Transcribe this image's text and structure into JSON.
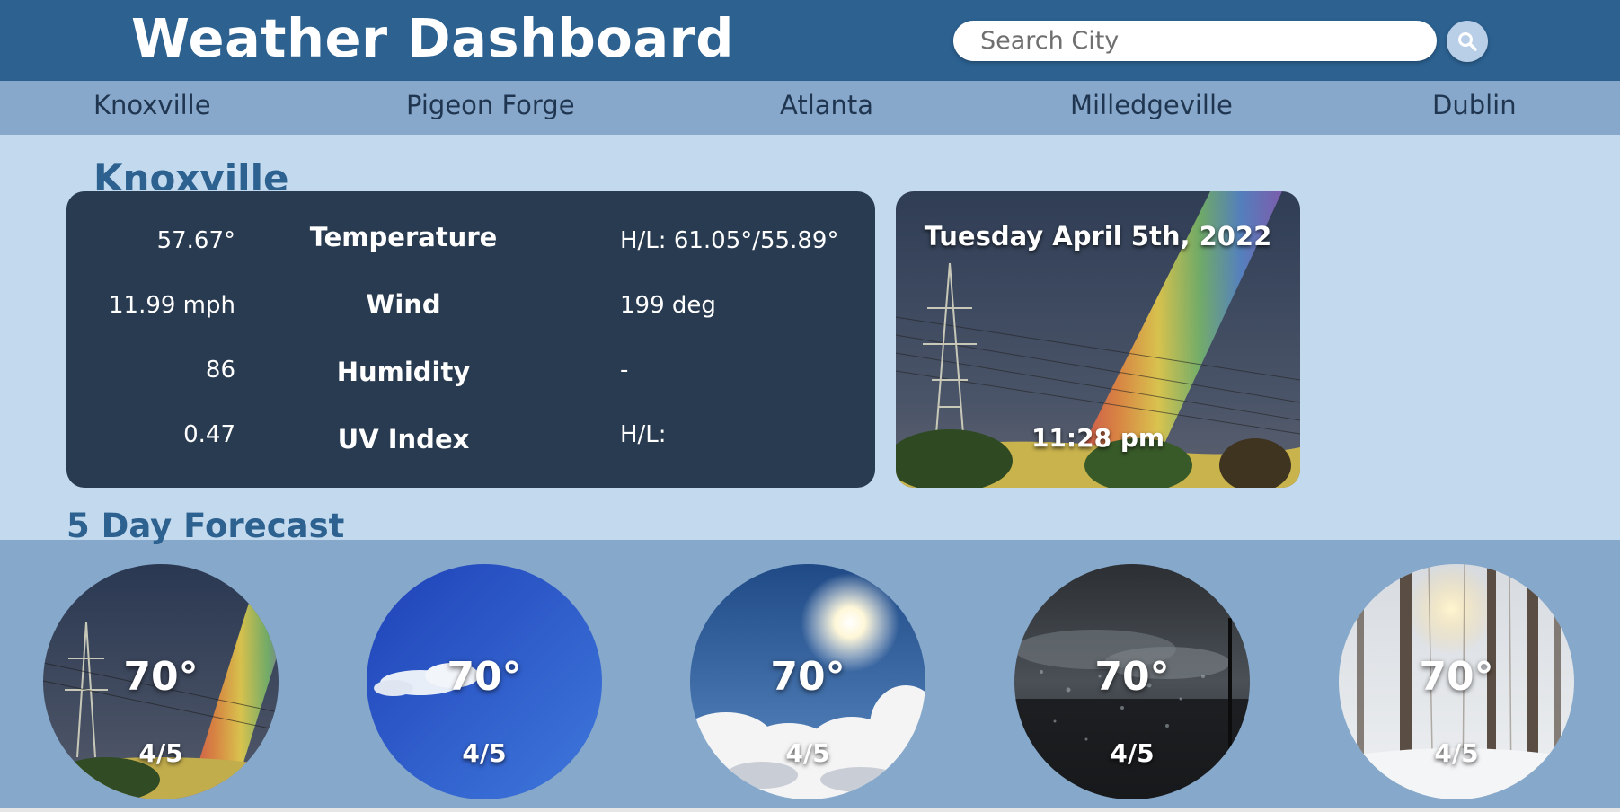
{
  "header": {
    "title": "Weather Dashboard",
    "search": {
      "placeholder": "Search City",
      "value": "",
      "button_icon": "search-icon"
    }
  },
  "nav": {
    "items": [
      "Knoxville",
      "Pigeon Forge",
      "Atlanta",
      "Milledgeville",
      "Dublin"
    ]
  },
  "current": {
    "city": "Knoxville",
    "rows": [
      {
        "value": "57.67°",
        "label": "Temperature",
        "extra": "H/L: 61.05°/55.89°"
      },
      {
        "value": "11.99 mph",
        "label": "Wind",
        "extra": "199 deg"
      },
      {
        "value": "86",
        "label": "Humidity",
        "extra": "-"
      },
      {
        "value": "0.47",
        "label": "UV Index",
        "extra": "H/L:"
      }
    ],
    "date": "Tuesday April 5th, 2022",
    "time": "11:28 pm"
  },
  "forecast": {
    "title": "5 Day Forecast",
    "days": [
      {
        "temp": "70°",
        "date": "4/5",
        "scene": "rainbow"
      },
      {
        "temp": "70°",
        "date": "4/5",
        "scene": "blue-sky"
      },
      {
        "temp": "70°",
        "date": "4/5",
        "scene": "sunny-clouds"
      },
      {
        "temp": "70°",
        "date": "4/5",
        "scene": "rainy-window"
      },
      {
        "temp": "70°",
        "date": "4/5",
        "scene": "snowy-forest"
      }
    ]
  },
  "colors": {
    "header_bg": "#2c6190",
    "nav_bg": "#87a8cb",
    "page_bg": "#c2d9ee",
    "card_bg": "#293b50",
    "accent_text": "#2c6190"
  }
}
